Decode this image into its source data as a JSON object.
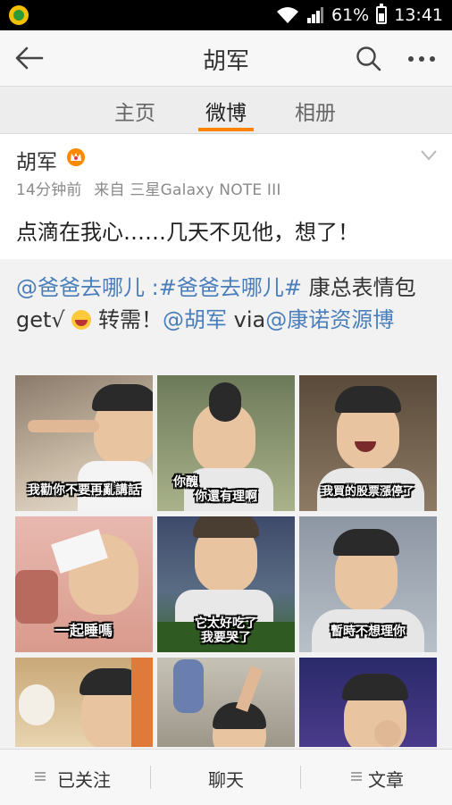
{
  "status_bar": {
    "battery": "61%",
    "battery_level": 0.61,
    "time": "13:41"
  },
  "header": {
    "title": "胡军"
  },
  "tabs": [
    {
      "label": "主页"
    },
    {
      "label": "微博"
    },
    {
      "label": "相册"
    }
  ],
  "tabs_active_index": 1,
  "post": {
    "author": "胡军",
    "time": "14分钟前",
    "source": "来自 三星Galaxy NOTE III",
    "text": "点滴在我心……几天不见他，想了！",
    "repost": {
      "mention_1": "@爸爸去哪儿",
      "colon": " :",
      "hashtag": "#爸爸去哪儿#",
      "text_1": " 康总表情包get√ ",
      "text_2": " 转需！",
      "mention_2": "@胡军",
      "via": " via",
      "mention_3": "@康诺资源博"
    },
    "images": [
      {
        "caption": "我勸你不要再亂講話"
      },
      {
        "caption_line1": "你醜",
        "caption_line2": "你還有理啊"
      },
      {
        "caption": "我買的股票漲停了"
      },
      {
        "caption": "一起睡嗎"
      },
      {
        "caption_line1": "它太好吃了",
        "caption_line2": "我要哭了"
      },
      {
        "caption": "暫時不想理你"
      },
      {
        "caption": ""
      },
      {
        "caption": ""
      },
      {
        "caption": ""
      }
    ]
  },
  "bottom_bar": {
    "followed_label": "已关注",
    "chat_label": "聊天",
    "article_label": "文章"
  },
  "colors": {
    "accent": "#ff8200",
    "link": "#4a7ebb"
  }
}
